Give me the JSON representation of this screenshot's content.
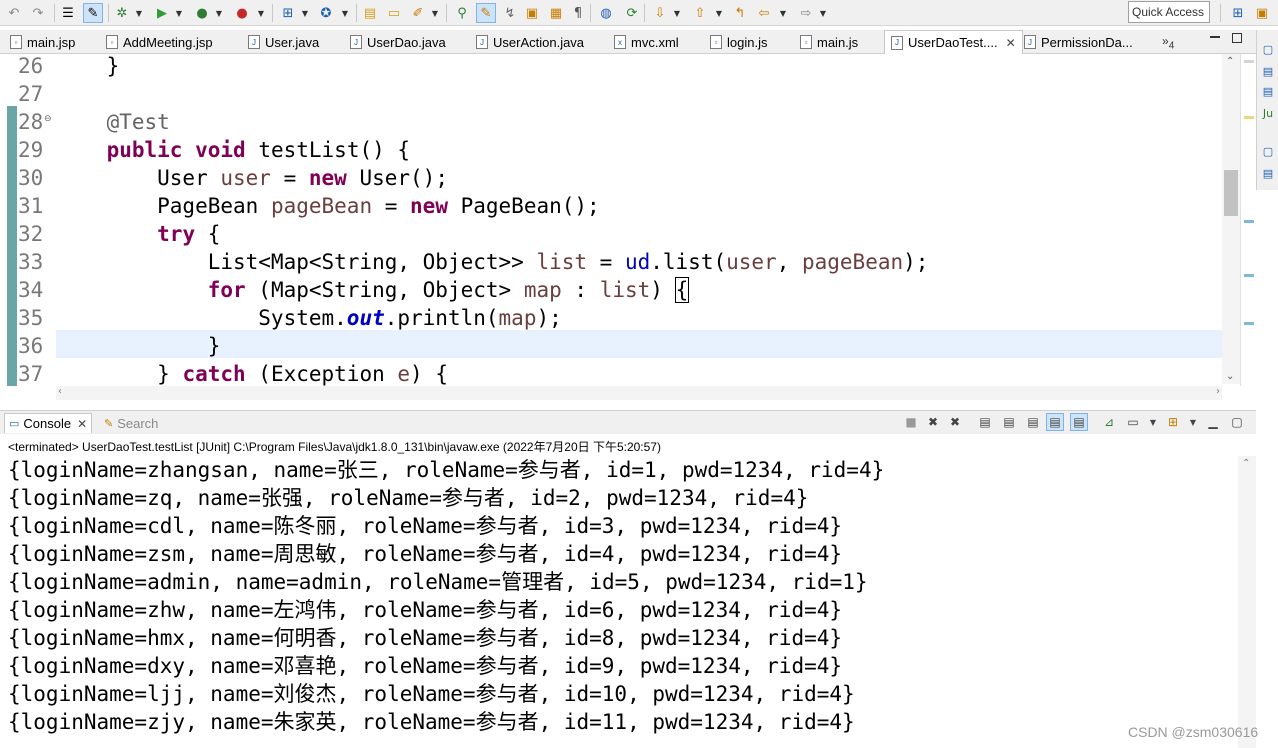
{
  "toolbar": {
    "quick_access_placeholder": "Quick Access"
  },
  "editor_tabs": [
    {
      "label": "main.jsp",
      "active": false
    },
    {
      "label": "AddMeeting.jsp",
      "active": false
    },
    {
      "label": "User.java",
      "active": false
    },
    {
      "label": "UserDao.java",
      "active": false
    },
    {
      "label": "UserAction.java",
      "active": false
    },
    {
      "label": "mvc.xml",
      "active": false
    },
    {
      "label": "login.js",
      "active": false
    },
    {
      "label": "main.js",
      "active": false
    },
    {
      "label": "UserDaoTest....",
      "active": true
    },
    {
      "label": "PermissionDa...",
      "active": false
    }
  ],
  "tabs_overflow": "»",
  "tabs_overflow_count": "4",
  "editor": {
    "line_numbers": [
      "26",
      "27",
      "28",
      "29",
      "30",
      "31",
      "32",
      "33",
      "34",
      "35",
      "36",
      "37"
    ]
  },
  "console": {
    "tab_console": "Console",
    "tab_search": "Search",
    "status": "<terminated> UserDaoTest.testList [JUnit] C:\\Program Files\\Java\\jdk1.8.0_131\\bin\\javaw.exe (2022年7月20日 下午5:20:57)",
    "output": [
      "{loginName=zhangsan, name=张三, roleName=参与者, id=1, pwd=1234, rid=4}",
      "{loginName=zq, name=张强, roleName=参与者, id=2, pwd=1234, rid=4}",
      "{loginName=cdl, name=陈冬丽, roleName=参与者, id=3, pwd=1234, rid=4}",
      "{loginName=zsm, name=周思敏, roleName=参与者, id=4, pwd=1234, rid=4}",
      "{loginName=admin, name=admin, roleName=管理者, id=5, pwd=1234, rid=1}",
      "{loginName=zhw, name=左鸿伟, roleName=参与者, id=6, pwd=1234, rid=4}",
      "{loginName=hmx, name=何明香, roleName=参与者, id=8, pwd=1234, rid=4}",
      "{loginName=dxy, name=邓喜艳, roleName=参与者, id=9, pwd=1234, rid=4}",
      "{loginName=ljj, name=刘俊杰, roleName=参与者, id=10, pwd=1234, rid=4}",
      "{loginName=zjy, name=朱家英, roleName=参与者, id=11, pwd=1234, rid=4}"
    ]
  },
  "watermark": "CSDN @zsm030616"
}
